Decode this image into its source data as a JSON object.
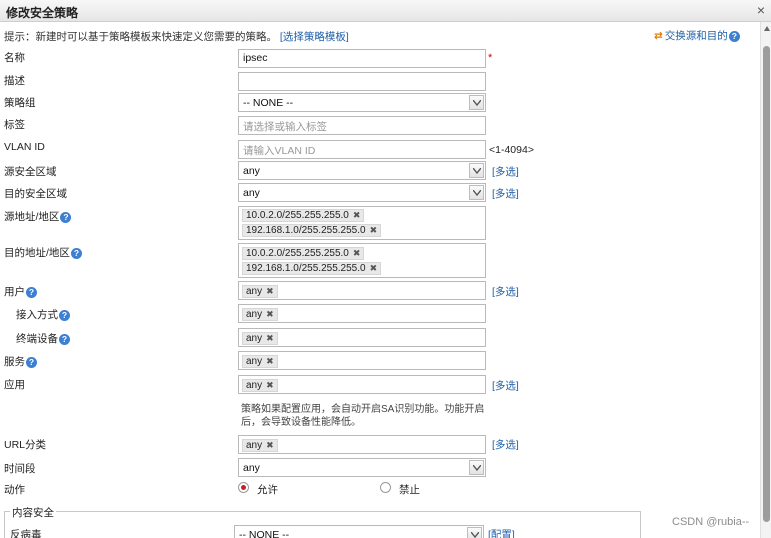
{
  "window": {
    "title": "修改安全策略",
    "close_glyph": "×"
  },
  "tip": {
    "text": "提示：新建时可以基于策略模板来快速定义您需要的策略。",
    "template_link": "[选择策略模板]"
  },
  "swap_link": "交换源和目的",
  "form": {
    "name": {
      "label": "名称",
      "value": "ipsec",
      "required_mark": "*"
    },
    "description": {
      "label": "描述",
      "value": ""
    },
    "policy_group": {
      "label": "策略组",
      "selected": "-- NONE --"
    },
    "tag": {
      "label": "标签",
      "placeholder": "请选择或输入标签"
    },
    "vlan_id": {
      "label": "VLAN ID",
      "placeholder": "请输入VLAN ID",
      "range_hint": "<1-4094>"
    },
    "src_zone": {
      "label": "源安全区域",
      "selected": "any",
      "multi_label": "[多选]"
    },
    "dst_zone": {
      "label": "目的安全区域",
      "selected": "any",
      "multi_label": "[多选]"
    },
    "src_addr": {
      "label": "源地址/地区",
      "tags": [
        "10.0.2.0/255.255.255.0",
        "192.168.1.0/255.255.255.0"
      ]
    },
    "dst_addr": {
      "label": "目的地址/地区",
      "tags": [
        "10.0.2.0/255.255.255.0",
        "192.168.1.0/255.255.255.0"
      ]
    },
    "user": {
      "label": "用户",
      "tags": [
        "any"
      ],
      "multi_label": "[多选]"
    },
    "access_method": {
      "label": "接入方式",
      "tags": [
        "any"
      ]
    },
    "terminal_device": {
      "label": "终端设备",
      "tags": [
        "any"
      ]
    },
    "service": {
      "label": "服务",
      "tags": [
        "any"
      ]
    },
    "application": {
      "label": "应用",
      "tags": [
        "any"
      ],
      "multi_label": "[多选]",
      "note": "策略如果配置应用，会自动开启SA识别功能。功能开启后，会导致设备性能降低。"
    },
    "url_category": {
      "label": "URL分类",
      "tags": [
        "any"
      ],
      "multi_label": "[多选]"
    },
    "time_range": {
      "label": "时间段",
      "selected": "any"
    },
    "action": {
      "label": "动作",
      "options": [
        "允许",
        "禁止"
      ],
      "selected_index": 0
    }
  },
  "content_security": {
    "legend": "内容安全",
    "antivirus": {
      "label": "反病毒",
      "selected": "-- NONE --",
      "config_link": "[配置]"
    }
  },
  "icons": {
    "help": "?",
    "tag_remove": "✖",
    "swap": "⇄"
  },
  "colors": {
    "link": "#1f5fa8",
    "help_icon": "#3d7fd0",
    "radio_selected": "#cc1f1f",
    "required": "#dd0000"
  },
  "watermark": "CSDN @rubia--"
}
